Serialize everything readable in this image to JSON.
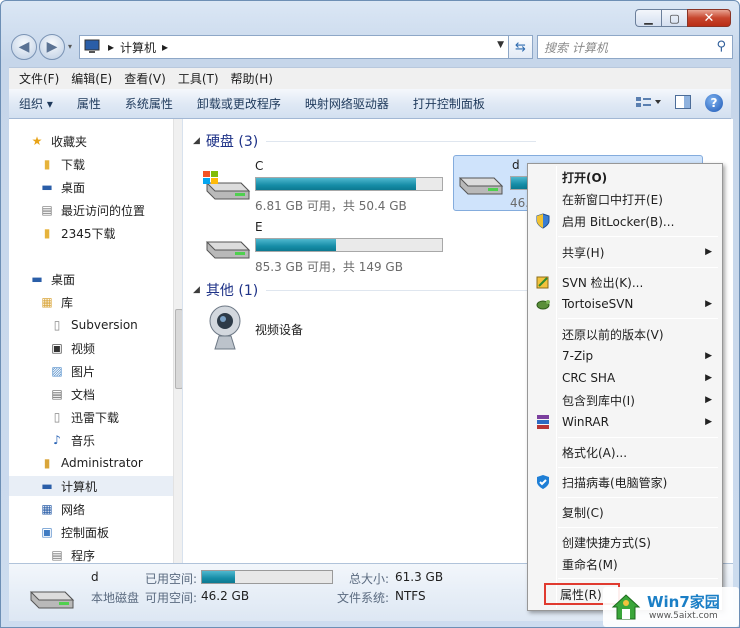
{
  "window": {
    "buttons": {
      "minimize": "▁",
      "maximize": "▢",
      "close": "✕"
    }
  },
  "nav": {
    "back_icon": "◀",
    "forward_icon": "▶",
    "address_crumbs": [
      "▸",
      "计算机",
      "▸"
    ],
    "search_placeholder": "搜索 计算机"
  },
  "menubar": [
    "文件(F)",
    "编辑(E)",
    "查看(V)",
    "工具(T)",
    "帮助(H)"
  ],
  "commands": [
    "组织 ▾",
    "属性",
    "系统属性",
    "卸载或更改程序",
    "映射网络驱动器",
    "打开控制面板"
  ],
  "sidebar": {
    "items": [
      {
        "label": "收藏夹",
        "icon": "star-icon"
      },
      {
        "label": "下载",
        "icon": "folder-icon"
      },
      {
        "label": "桌面",
        "icon": "desktop-icon"
      },
      {
        "label": "最近访问的位置",
        "icon": "recent-icon"
      },
      {
        "label": "2345下载",
        "icon": "folder-icon"
      },
      {
        "label": "桌面",
        "icon": "desktop-icon"
      },
      {
        "label": "库",
        "icon": "library-icon"
      },
      {
        "label": "Subversion",
        "icon": "doc-icon"
      },
      {
        "label": "视频",
        "icon": "video-icon"
      },
      {
        "label": "图片",
        "icon": "picture-icon"
      },
      {
        "label": "文档",
        "icon": "document-icon"
      },
      {
        "label": "迅雷下载",
        "icon": "doc-icon"
      },
      {
        "label": "音乐",
        "icon": "music-icon"
      },
      {
        "label": "Administrator",
        "icon": "user-folder-icon"
      },
      {
        "label": "计算机",
        "icon": "computer-icon"
      },
      {
        "label": "网络",
        "icon": "network-icon"
      },
      {
        "label": "控制面板",
        "icon": "control-panel-icon"
      },
      {
        "label": "程序",
        "icon": "programs-icon"
      }
    ]
  },
  "main": {
    "group_disks": "硬盘 (3)",
    "group_other": "其他 (1)",
    "drives": [
      {
        "name": "C",
        "info": "6.81 GB 可用，共 50.4 GB",
        "used_fraction": 0.86
      },
      {
        "name": "d",
        "info": "46.2 GB 可用，共 61.3 GB",
        "used_fraction": 0.25
      },
      {
        "name": "E",
        "info": "85.3 GB 可用，共 149 GB",
        "used_fraction": 0.43
      }
    ],
    "video_device": "视频设备"
  },
  "details": {
    "name": "d",
    "type": "本地磁盘",
    "used_label": "已用空间:",
    "free_label": "可用空间:",
    "free_value": "46.2 GB",
    "total_label": "总大小:",
    "total_value": "61.3 GB",
    "fs_label": "文件系统:",
    "fs_value": "NTFS",
    "used_fraction": 0.25
  },
  "context_menu": {
    "items": [
      {
        "label": "打开(O)",
        "bold": true
      },
      {
        "label": "在新窗口中打开(E)"
      },
      {
        "label": "启用 BitLocker(B)...",
        "icon": "shield-icon"
      },
      {
        "label": "共享(H)",
        "submenu": true
      },
      {
        "label": "SVN 检出(K)...",
        "icon": "svn-checkout-icon"
      },
      {
        "label": "TortoiseSVN",
        "icon": "tortoise-icon",
        "submenu": true
      },
      {
        "label": "还原以前的版本(V)"
      },
      {
        "label": "7-Zip",
        "submenu": true
      },
      {
        "label": "CRC SHA",
        "submenu": true
      },
      {
        "label": "包含到库中(I)",
        "submenu": true
      },
      {
        "label": "WinRAR",
        "icon": "winrar-icon",
        "submenu": true
      },
      {
        "label": "格式化(A)..."
      },
      {
        "label": "扫描病毒(电脑管家)",
        "icon": "pc-manager-icon"
      },
      {
        "label": "复制(C)"
      },
      {
        "label": "创建快捷方式(S)"
      },
      {
        "label": "重命名(M)"
      },
      {
        "label": "属性(R)"
      }
    ]
  },
  "watermark": {
    "title": "Win7家园",
    "url": "www.5aixt.com"
  },
  "colors": {
    "accent": "#1e3287",
    "bar": "#168da7",
    "highlight_border": "#e03a2f"
  }
}
